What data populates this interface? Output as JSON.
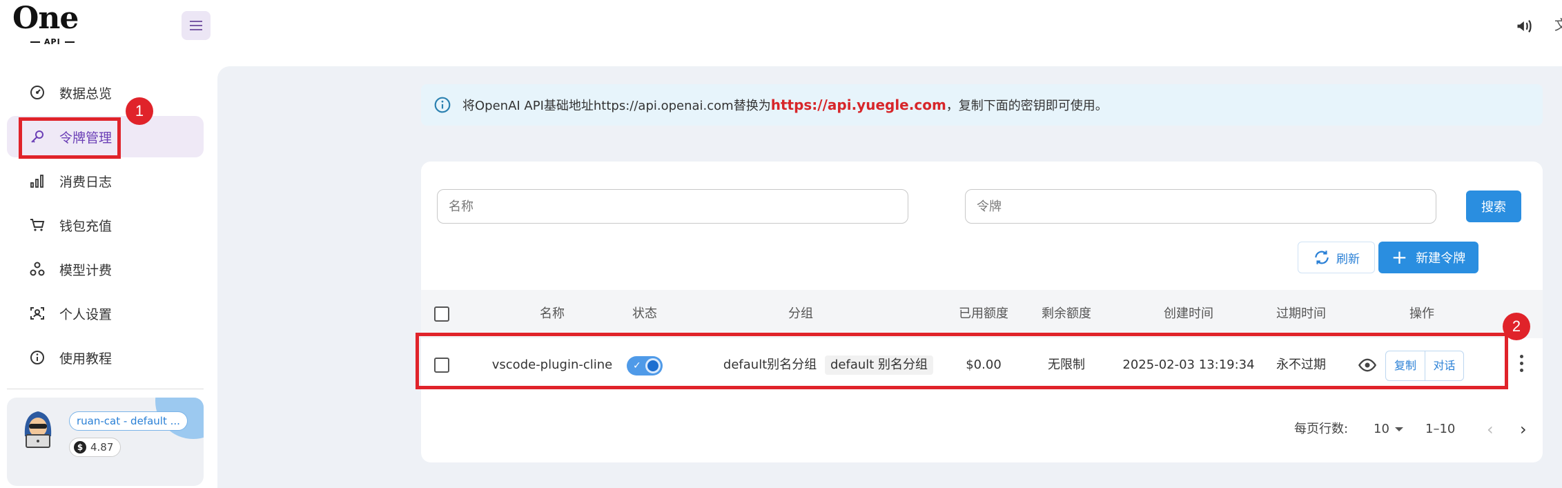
{
  "header": {
    "logo_text": "One",
    "logo_sub": "API"
  },
  "sidebar": {
    "items": [
      {
        "label": "数据总览",
        "icon": "gauge-icon",
        "active": false
      },
      {
        "label": "令牌管理",
        "icon": "key-icon",
        "active": true
      },
      {
        "label": "消费日志",
        "icon": "bar-chart-icon",
        "active": false
      },
      {
        "label": "钱包充值",
        "icon": "cart-icon",
        "active": false
      },
      {
        "label": "模型计费",
        "icon": "models-icon",
        "active": false
      },
      {
        "label": "个人设置",
        "icon": "face-scan-icon",
        "active": false
      },
      {
        "label": "使用教程",
        "icon": "info-icon",
        "active": false
      }
    ],
    "user": {
      "tag": "ruan-cat - default ...",
      "balance": "4.87"
    }
  },
  "notice": {
    "prefix": "将OpenAI API基础地址https://api.openai.com替换为",
    "highlight": "https://api.yuegle.com",
    "suffix": "，复制下面的密钥即可使用。"
  },
  "search": {
    "name_placeholder": "名称",
    "token_placeholder": "令牌",
    "search_label": "搜索"
  },
  "toolbar": {
    "refresh_label": "刷新",
    "new_label": "新建令牌"
  },
  "table": {
    "headers": [
      "名称",
      "状态",
      "分组",
      "已用额度",
      "剩余额度",
      "创建时间",
      "过期时间",
      "操作"
    ],
    "rows": [
      {
        "name": "vscode-plugin-cline",
        "status_enabled": true,
        "group_text": "default别名分组",
        "group_tag": "default 别名分组",
        "used": "$0.00",
        "remaining": "无限制",
        "created": "2025-02-03 13:19:34",
        "expires": "永不过期",
        "copy_label": "复制",
        "chat_label": "对话"
      }
    ]
  },
  "pagination": {
    "rows_per_page_label": "每页行数:",
    "rows_per_page": "10",
    "range": "1–10"
  },
  "annotations": {
    "badge1": "1",
    "badge2": "2",
    "color": "#e0232a"
  }
}
